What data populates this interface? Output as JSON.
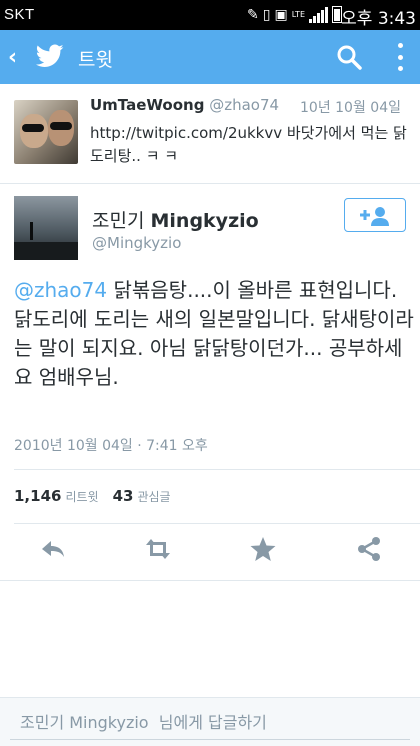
{
  "status_bar": {
    "carrier": "SKT",
    "lte": "LTE",
    "clock": "오후 3:43"
  },
  "app_bar": {
    "title": "트윗",
    "back_glyph": "‹",
    "icons": [
      "back-icon",
      "twitter-bird-icon",
      "search-icon",
      "more-vertical-icon"
    ],
    "accent_color": "#55acee"
  },
  "parent_tweet": {
    "display_name": "UmTaeWoong",
    "handle": "@zhao74",
    "date": "10년 10월 04일",
    "text": "http://twitpic.com/2ukkvv 바닷가에서 먹는 닭도리탕.. ㅋ ㅋ"
  },
  "main_tweet": {
    "display_name": "조민기",
    "display_name_latin": "Mingkyzio",
    "handle": "@Mingkyzio",
    "follow_label": "+👤",
    "mention": "@zhao74",
    "text": " 닭볶음탕....이 올바른 표현입니다. 닭도리에 도리는 새의 일본말입니다. 닭새탕이라는 말이 되지요. 아님 닭닭탕이던가... 공부하세요 엄배우님.",
    "timestamp": "2010년 10월 04일 · 7:41 오후"
  },
  "stats": {
    "retweets": "1,146",
    "retweets_label": "리트윗",
    "favorites": "43",
    "favorites_label": "관심글"
  },
  "actions": [
    "reply-icon",
    "retweet-icon",
    "favorite-star-icon",
    "share-icon"
  ],
  "reply": {
    "placeholder": "조민기 Mingkyzio  님에게 답글하기"
  }
}
